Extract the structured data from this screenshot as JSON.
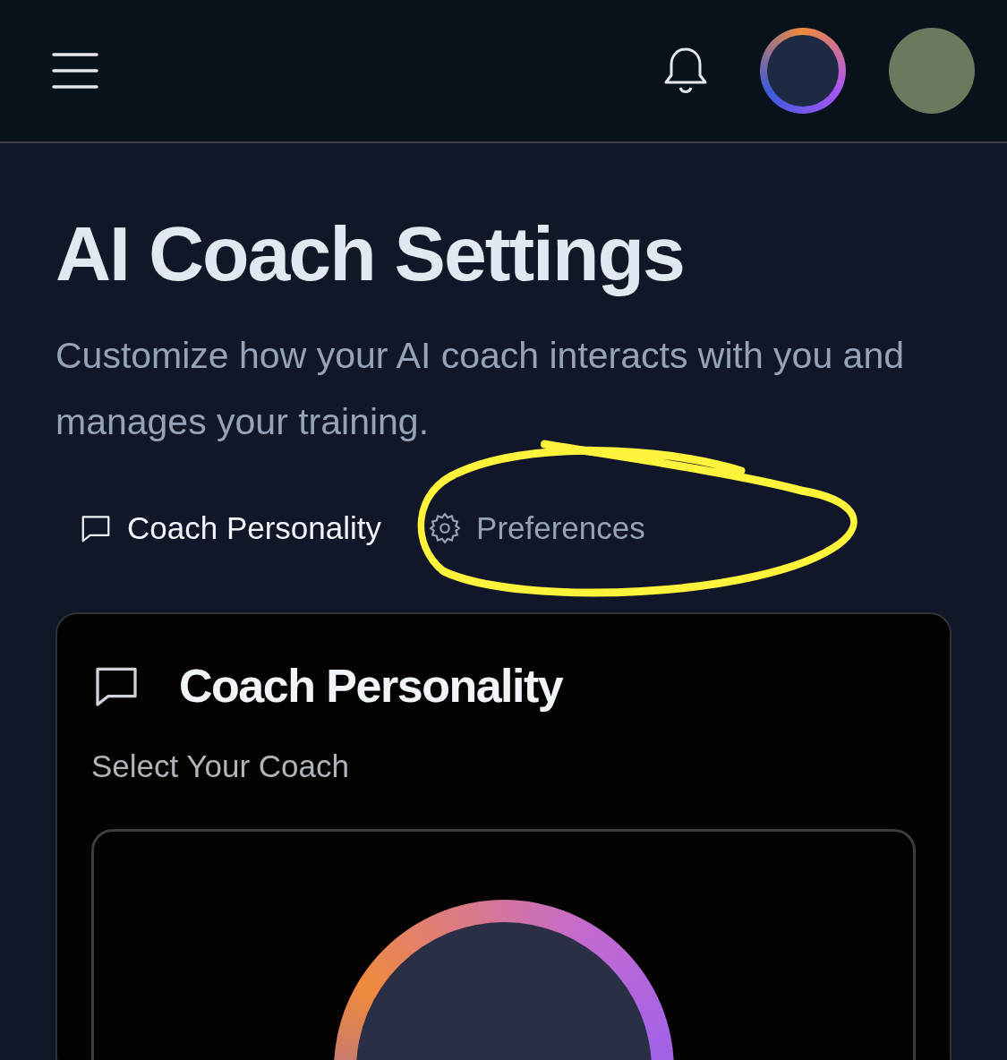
{
  "title": "AI Coach Settings",
  "subtitle": "Customize how your AI coach interacts with you and manages your training.",
  "tabs": [
    {
      "label": "Coach Personality",
      "kind": "chat",
      "selected": true
    },
    {
      "label": "Preferences",
      "kind": "gear",
      "selected": false
    }
  ],
  "section": {
    "title": "Coach Personality",
    "label": "Select Your Coach"
  }
}
